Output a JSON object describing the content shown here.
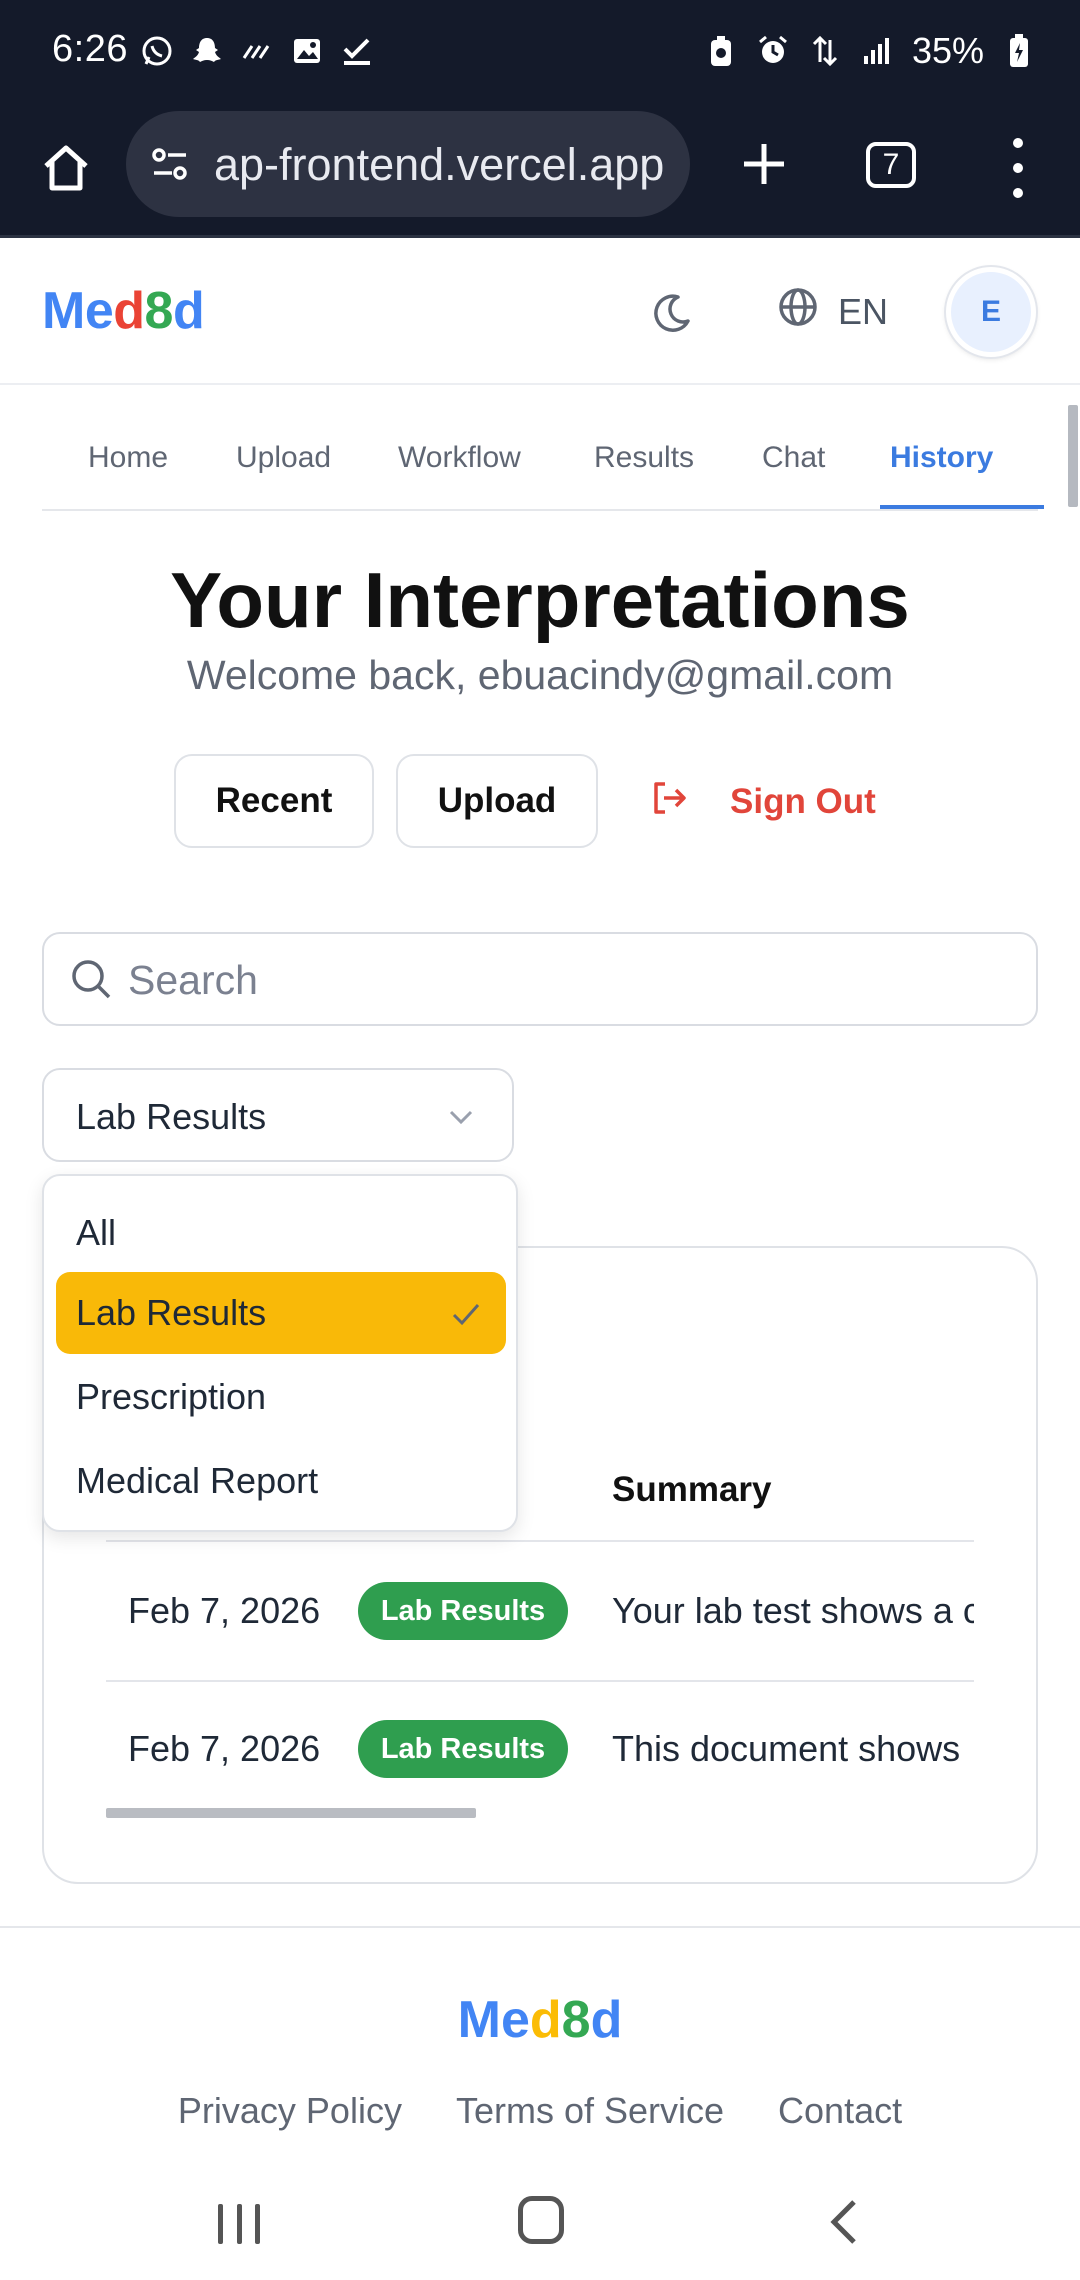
{
  "status_bar": {
    "time": "6:26",
    "battery": "35%",
    "left_icons": [
      "whatsapp-icon",
      "snapchat-icon",
      "signal-wave-icon",
      "gallery-icon",
      "checkmark-icon"
    ],
    "right_icons": [
      "battery-saver-icon",
      "alarm-icon",
      "data-transfer-icon",
      "cellular-signal-icon",
      "battery-charging-icon"
    ]
  },
  "browser": {
    "url_prefix": "ap-frontend.vercel.app",
    "tab_count": "7"
  },
  "header": {
    "logo": {
      "part1": "Me",
      "part2": "d",
      "part3": "8",
      "part4": "d"
    },
    "language": "EN",
    "avatar_initial": "E"
  },
  "nav": {
    "tabs": [
      {
        "label": "Home"
      },
      {
        "label": "Upload"
      },
      {
        "label": "Workflow"
      },
      {
        "label": "Results"
      },
      {
        "label": "Chat"
      },
      {
        "label": "History"
      }
    ],
    "active_tab": "History"
  },
  "page": {
    "title": "Your Interpretations",
    "subtitle": "Welcome back, ebuacindy@gmail.com",
    "buttons": {
      "recent": "Recent",
      "upload": "Upload",
      "sign_out": "Sign Out"
    }
  },
  "search": {
    "placeholder": "Search",
    "value": ""
  },
  "filter": {
    "selected": "Lab Results",
    "options": [
      "All",
      "Lab Results",
      "Prescription",
      "Medical Report"
    ]
  },
  "table": {
    "columns": {
      "summary": "Summary"
    },
    "rows": [
      {
        "date": "Feb 7, 2026",
        "type": "Lab Results",
        "summary": "Your lab test shows a c"
      },
      {
        "date": "Feb 7, 2026",
        "type": "Lab Results",
        "summary": "This document shows"
      }
    ]
  },
  "footer": {
    "logo": {
      "part1": "Me",
      "part2": "d",
      "part3": "8",
      "part4": "d"
    },
    "links": [
      "Privacy Policy",
      "Terms of Service",
      "Contact"
    ]
  },
  "colors": {
    "accent": "#3b7be0",
    "danger": "#e1453a",
    "selected_option": "#f9b908",
    "badge_green": "#2f9e4f",
    "status_bar": "#141a2a"
  }
}
